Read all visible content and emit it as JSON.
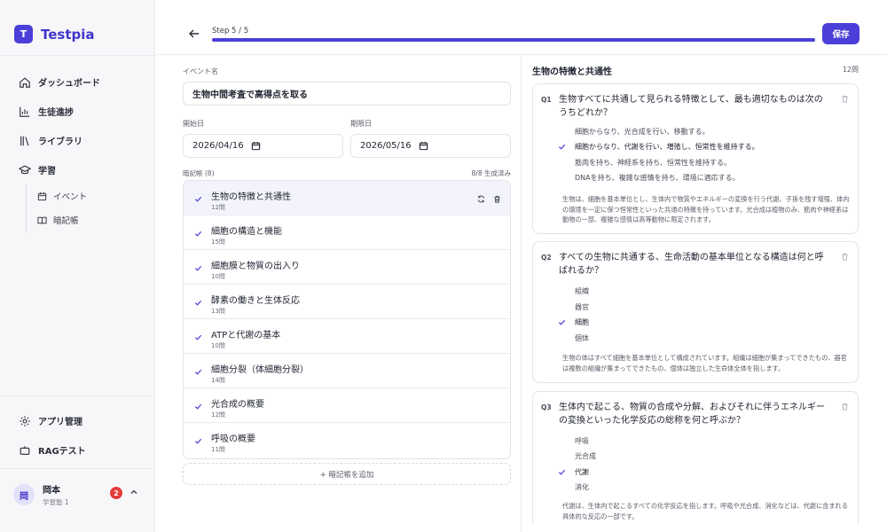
{
  "brand": {
    "logo_letter": "T",
    "name": "Testpia"
  },
  "nav": {
    "dashboard": "ダッシュボード",
    "progress": "生徒進捗",
    "library": "ライブラリ",
    "learning": "学習",
    "event": "イベント",
    "notebook": "暗記帳",
    "app_admin": "アプリ管理",
    "rag_test": "RAGテスト"
  },
  "user": {
    "avatar": "岡",
    "name": "岡本",
    "role": "学習塾 1",
    "notifications": "2"
  },
  "topbar": {
    "step": "Step 5 / 5",
    "progress": 1.0,
    "save": "保存"
  },
  "form": {
    "event_name_label": "イベント名",
    "event_name": "生物中間考査で高得点を取る",
    "start_label": "開始日",
    "start_date": "2026/04/16",
    "due_label": "期限日",
    "due_date": "2026/05/16",
    "notebooks_label": "暗記帳 (8)",
    "generated": "8/8 生成済み",
    "add_notebook": "+ 暗記帳を追加"
  },
  "notebooks": [
    {
      "title": "生物の特徴と共通性",
      "count": "12問"
    },
    {
      "title": "細胞の構造と機能",
      "count": "15問"
    },
    {
      "title": "細胞膜と物質の出入り",
      "count": "10問"
    },
    {
      "title": "酵素の働きと生体反応",
      "count": "13問"
    },
    {
      "title": "ATPと代謝の基本",
      "count": "10問"
    },
    {
      "title": "細胞分裂（体細胞分裂）",
      "count": "14問"
    },
    {
      "title": "光合成の概要",
      "count": "12問"
    },
    {
      "title": "呼吸の概要",
      "count": "11問"
    }
  ],
  "questions_panel": {
    "title": "生物の特徴と共通性",
    "count": "12問"
  },
  "questions": [
    {
      "no": "Q1",
      "text": "生物すべてに共通して見られる特徴として、最も適切なものは次のうちどれか？",
      "options": [
        "細胞からなり、光合成を行い、移動する。",
        "細胞からなり、代謝を行い、増殖し、恒常性を維持する。",
        "筋肉を持ち、神経系を持ち、恒常性を維持する。",
        "DNAを持ち、複雑な感情を持ち、環境に適応する。"
      ],
      "correct": 1,
      "explanation": "生物は、細胞を基本単位とし、生体内で物質やエネルギーの変換を行う代謝、子孫を残す増殖、体内の環境を一定に保つ恒常性といった共通の特徴を持っています。光合成は植物のみ、筋肉や神経系は動物の一部、複雑な感情は高等動物に限定されます。"
    },
    {
      "no": "Q2",
      "text": "すべての生物に共通する、生命活動の基本単位となる構造は何と呼ばれるか？",
      "options": [
        "組織",
        "器官",
        "細胞",
        "個体"
      ],
      "correct": 2,
      "explanation": "生物の体はすべて細胞を基本単位として構成されています。組織は細胞が集まってできたもの、器官は複数の組織が集まってできたもの、個体は独立した生命体全体を指します。"
    },
    {
      "no": "Q3",
      "text": "生体内で起こる、物質の合成や分解、およびそれに伴うエネルギーの変換といった化学反応の総称を何と呼ぶか？",
      "options": [
        "呼吸",
        "光合成",
        "代謝",
        "消化"
      ],
      "correct": 2,
      "explanation": "代謝は、生体内で起こるすべての化学反応を指します。呼吸や光合成、消化などは、代謝に含まれる具体的な反応の一部です。"
    }
  ],
  "colors": {
    "accent": "#4a3fd8",
    "badge": "#e43b3b",
    "check": "#4a3fd8"
  }
}
